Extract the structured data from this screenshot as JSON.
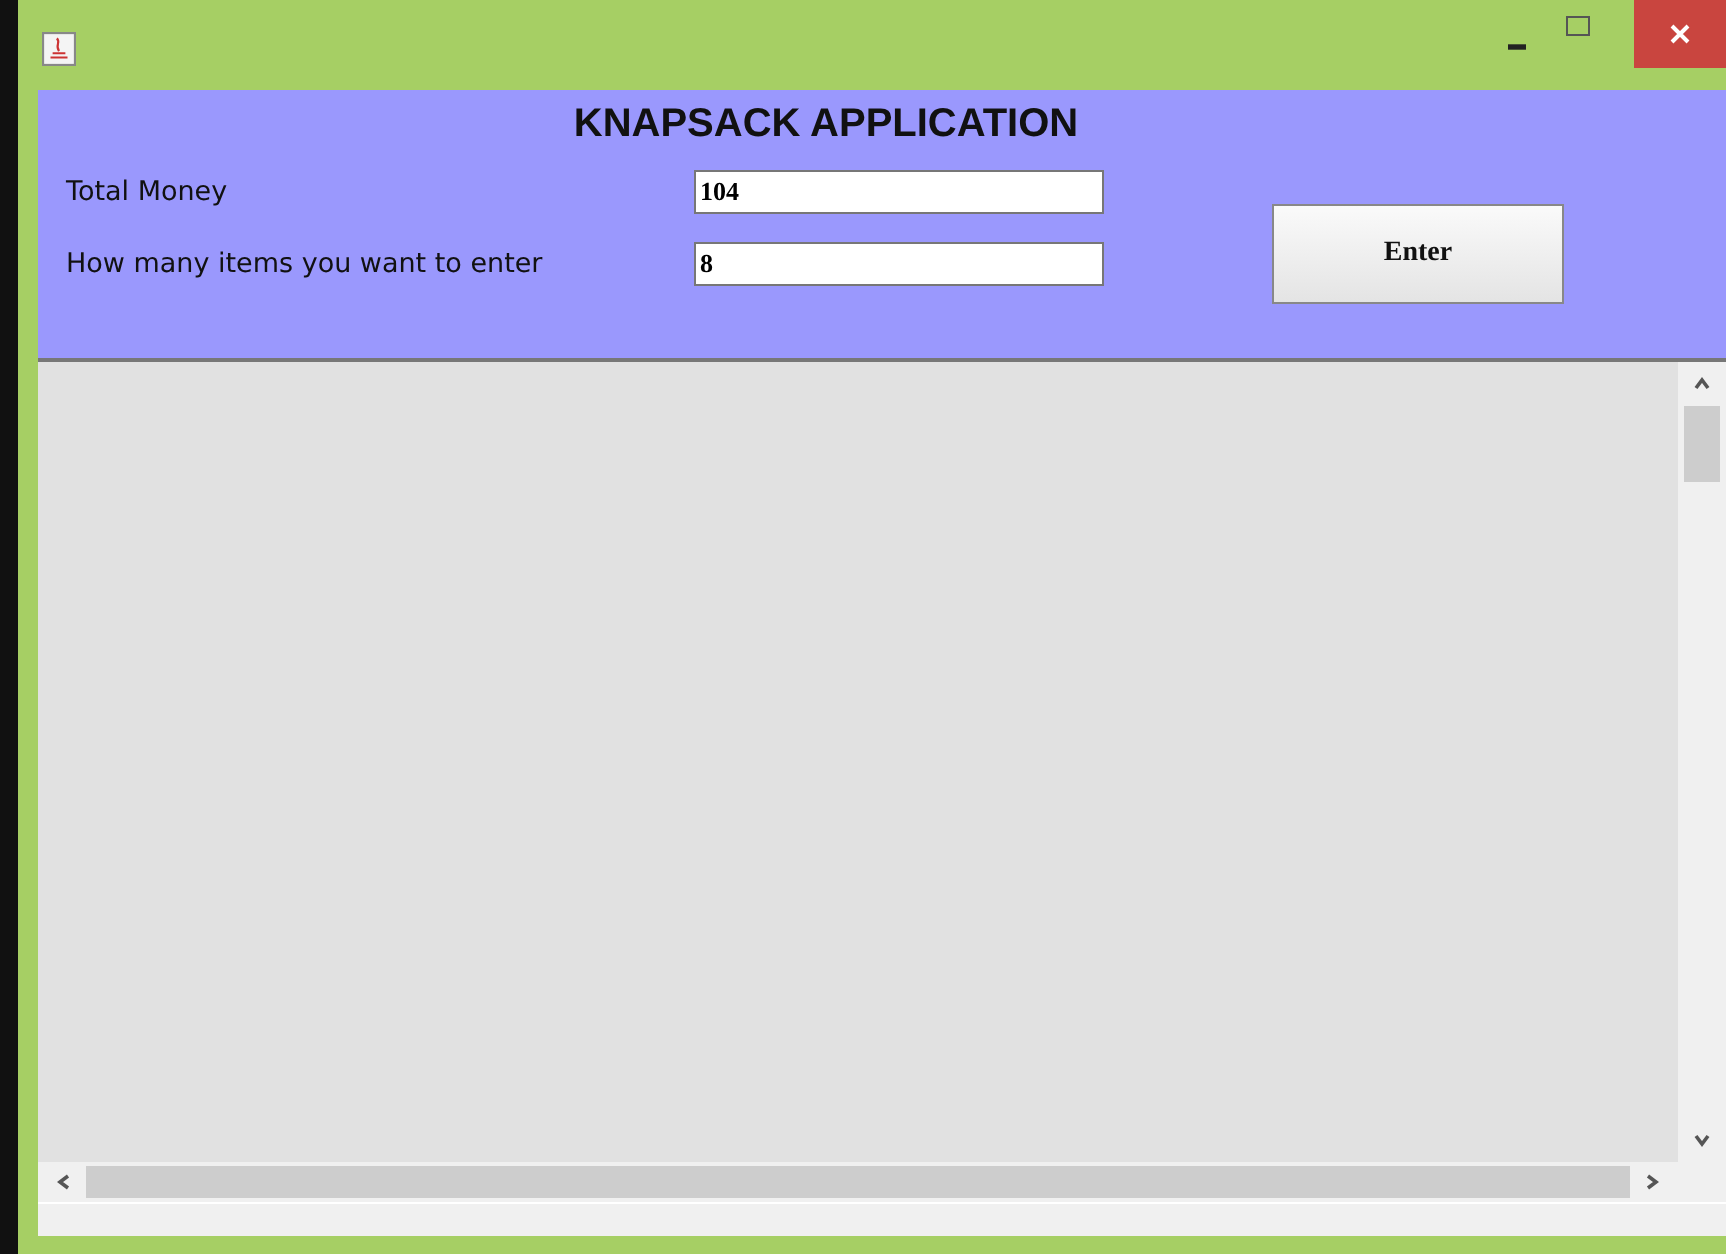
{
  "header": {
    "title": "KNAPSACK APPLICATION"
  },
  "fields": [
    {
      "label": "Total Money",
      "value": "104"
    },
    {
      "label": "How many items you want to enter",
      "value": "8"
    }
  ],
  "buttons": [
    "Enter"
  ]
}
